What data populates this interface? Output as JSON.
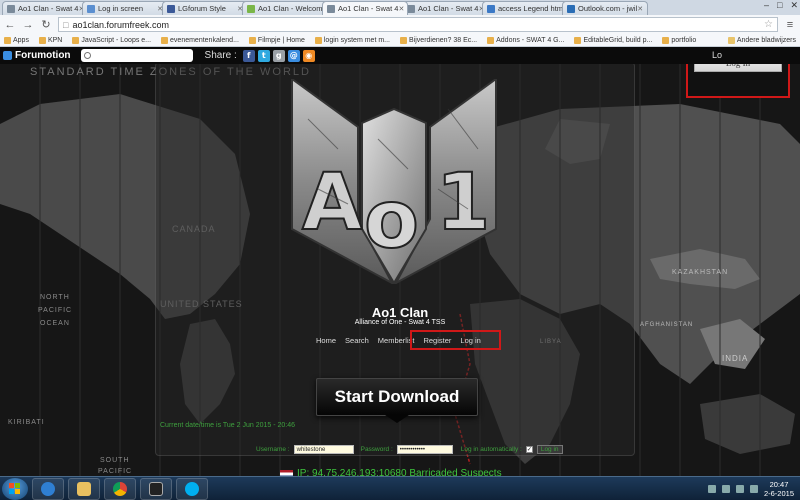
{
  "browser": {
    "tabs": [
      {
        "title": "Ao1 Clan - Swat 4",
        "active": false
      },
      {
        "title": "Log in screen",
        "active": false
      },
      {
        "title": "LGforum Style",
        "active": false
      },
      {
        "title": "Ao1 Clan - Welcom",
        "active": false
      },
      {
        "title": "Ao1 Clan - Swat 4",
        "active": true
      },
      {
        "title": "Ao1 Clan - Swat 4",
        "active": false
      },
      {
        "title": "access Legend htm",
        "active": false
      },
      {
        "title": "Outlook.com - jwil",
        "active": false
      }
    ],
    "address": "ao1clan.forumfreek.com",
    "bookmarks": [
      "Apps",
      "KPN",
      "JavaScript - Loops e...",
      "evenementenkalend...",
      "Filmpje | Home",
      "login system met m...",
      "Bijverdienen? 38 Ec...",
      "Addons - SWAT 4 G...",
      "EditableGrid, build p...",
      "portfolio"
    ],
    "other_bookmarks": "Andere bladwijzers"
  },
  "toolbar": {
    "brand": "Forumotion",
    "share_label": "Share :",
    "share_icons": [
      "f",
      "t",
      "g",
      "@",
      "rss"
    ],
    "login_label": "Lo"
  },
  "map": {
    "title": "STANDARD TIME ZONES OF THE WORLD",
    "labels": [
      "CANADA",
      "UNITED STATES",
      "NORTH",
      "PACIFIC",
      "OCEAN",
      "KIRIBATI",
      "SOUTH",
      "PACIFIC",
      "INDIA",
      "KAZAKHSTAN",
      "AFGHANISTAN",
      "LIBYA"
    ]
  },
  "site": {
    "title": "Ao1 Clan",
    "subtitle": "Alliance of One - Swat 4 TSS",
    "nav": [
      "Home",
      "Search",
      "Memberlist",
      "Register",
      "Log in"
    ],
    "download_label": "Start Download",
    "date_line": "Current date/time is Tue 2 Jun 2015 - 20:46",
    "login": {
      "username_label": "Username :",
      "username_value": "whitestone",
      "password_label": "Password :",
      "password_value": "••••••••••••",
      "auto_label": "Log in automatically :",
      "button": "Log in"
    },
    "server": "IP: 94.75.246.193:10680   Barricaded Suspects"
  },
  "popup": {
    "login_button": "Log In"
  },
  "taskbar": {
    "time": "20:47",
    "date": "2-6-2015"
  }
}
